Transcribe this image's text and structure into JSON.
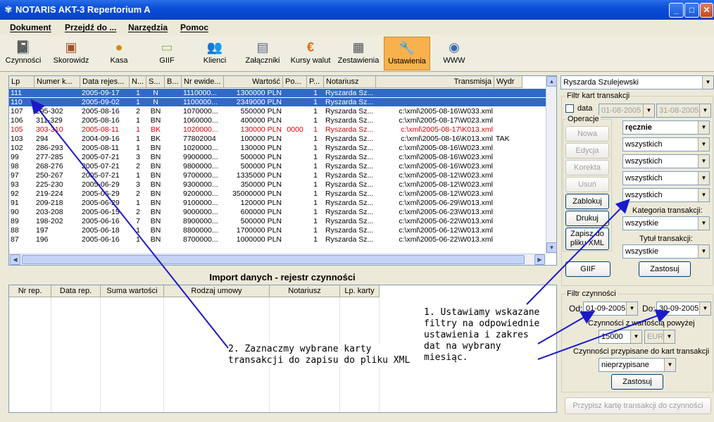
{
  "window": {
    "title": "NOTARIS AKT-3 Repertorium A",
    "icon": "app-icon",
    "min": "_",
    "max": "□",
    "close": "✕"
  },
  "menu": [
    "Dokument",
    "Przejdź do ...",
    "Narzędzia",
    "Pomoc"
  ],
  "toolbar": [
    {
      "label": "Czynności",
      "icon": "notebook-icon"
    },
    {
      "label": "Skorowidz",
      "icon": "index-book-icon"
    },
    {
      "label": "Kasa",
      "icon": "coins-icon"
    },
    {
      "label": "GIIF",
      "icon": "folder-icon"
    },
    {
      "label": "Klienci",
      "icon": "people-icon"
    },
    {
      "label": "Załączniki",
      "icon": "attachment-icon"
    },
    {
      "label": "Kursy walut",
      "icon": "euro-icon"
    },
    {
      "label": "Zestawienia",
      "icon": "report-icon"
    },
    {
      "label": "Ustawienia",
      "icon": "tools-icon"
    },
    {
      "label": "WWW",
      "icon": "globe-icon"
    }
  ],
  "colors": {
    "accent": "#316ac5",
    "active_tab": "#f7b24d",
    "red_row": "#e00000",
    "arrow": "#1a1acc"
  },
  "grid": {
    "headers": [
      "Lp",
      "Numer k...",
      "Data rejes...",
      "N...",
      "S...",
      "B...",
      "Nr ewide...",
      "Wartość",
      "Po...",
      "P...",
      "Notariusz",
      "Transmisja",
      "Wydr"
    ],
    "rows": [
      [
        "111",
        "",
        "2005-09-17",
        "1",
        "N",
        "",
        "1110000...",
        "1300000 PLN",
        "",
        "1",
        "Ryszarda Sz...",
        "",
        ""
      ],
      [
        "110",
        "",
        "2005-09-02",
        "1",
        "N",
        "",
        "1100000...",
        "2349000 PLN",
        "",
        "1",
        "Ryszarda Sz...",
        "",
        ""
      ],
      [
        "107",
        "295-302",
        "2005-08-16",
        "2",
        "BN",
        "",
        "1070000...",
        "550000 PLN",
        "",
        "1",
        "Ryszarda Sz...",
        "c:\\xml\\2005-08-16\\W033.xml",
        ""
      ],
      [
        "106",
        "311-329",
        "2005-08-16",
        "1",
        "BN",
        "",
        "1060000...",
        "400000 PLN",
        "",
        "1",
        "Ryszarda Sz...",
        "c:\\xml\\2005-08-17\\W023.xml",
        ""
      ],
      [
        "105",
        "303-310",
        "2005-08-11",
        "1",
        "BK",
        "",
        "1020000...",
        "130000 PLN",
        "0000",
        "1",
        "Ryszarda Sz...",
        "c:\\xml\\2005-08-17\\K013.xml",
        ""
      ],
      [
        "103",
        "294",
        "2004-09-16",
        "1",
        "BK",
        "",
        "77802004",
        "100000 PLN",
        "",
        "1",
        "Ryszarda Sz...",
        "c:\\xml\\2005-08-16\\K013.xml",
        "TAK"
      ],
      [
        "102",
        "286-293",
        "2005-08-11",
        "1",
        "BN",
        "",
        "1020000...",
        "130000 PLN",
        "",
        "1",
        "Ryszarda Sz...",
        "c:\\xml\\2005-08-16\\W023.xml",
        ""
      ],
      [
        "99",
        "277-285",
        "2005-07-21",
        "3",
        "BN",
        "",
        "9900000...",
        "500000 PLN",
        "",
        "1",
        "Ryszarda Sz...",
        "c:\\xml\\2005-08-16\\W023.xml",
        ""
      ],
      [
        "98",
        "268-276",
        "2005-07-21",
        "2",
        "BN",
        "",
        "9800000...",
        "500000 PLN",
        "",
        "1",
        "Ryszarda Sz...",
        "c:\\xml\\2005-08-16\\W023.xml",
        ""
      ],
      [
        "97",
        "250-267",
        "2005-07-21",
        "1",
        "BN",
        "",
        "9700000...",
        "1335000 PLN",
        "",
        "1",
        "Ryszarda Sz...",
        "c:\\xml\\2005-08-12\\W023.xml",
        ""
      ],
      [
        "93",
        "225-230",
        "2005-06-29",
        "3",
        "BN",
        "",
        "9300000...",
        "350000 PLN",
        "",
        "1",
        "Ryszarda Sz...",
        "c:\\xml\\2005-08-12\\W023.xml",
        ""
      ],
      [
        "92",
        "219-224",
        "2005-06-29",
        "2",
        "BN",
        "",
        "9200000...",
        "35000000 PLN",
        "",
        "1",
        "Ryszarda Sz...",
        "c:\\xml\\2005-08-12\\W023.xml",
        ""
      ],
      [
        "91",
        "209-218",
        "2005-06-29",
        "1",
        "BN",
        "",
        "9100000...",
        "120000 PLN",
        "",
        "1",
        "Ryszarda Sz...",
        "c:\\xml\\2005-06-29\\W013.xml",
        ""
      ],
      [
        "90",
        "203-208",
        "2005-06-15",
        "2",
        "BN",
        "",
        "9000000...",
        "600000 PLN",
        "",
        "1",
        "Ryszarda Sz...",
        "c:\\xml\\2005-06-23\\W013.xml",
        ""
      ],
      [
        "89",
        "198-202",
        "2005-06-16",
        "7",
        "BN",
        "",
        "8900000...",
        "500000 PLN",
        "",
        "1",
        "Ryszarda Sz...",
        "c:\\xml\\2005-06-22\\W013.xml",
        ""
      ],
      [
        "88",
        "197",
        "2005-06-18",
        "1",
        "BN",
        "",
        "8800000...",
        "1700000 PLN",
        "",
        "1",
        "Ryszarda Sz...",
        "c:\\xml\\2005-06-12\\W013.xml",
        ""
      ],
      [
        "87",
        "196",
        "2005-06-16",
        "1",
        "BN",
        "",
        "8700000...",
        "1000000 PLN",
        "",
        "1",
        "Ryszarda Sz...",
        "c:\\xml\\2005-06-22\\W013.xml",
        ""
      ]
    ],
    "selected_rows": [
      0,
      1
    ],
    "red_rows": [
      4
    ]
  },
  "import": {
    "title": "Import danych - rejestr czynności",
    "headers": [
      "Nr rep.",
      "Data rep.",
      "Suma wartości",
      "Rodzaj umowy",
      "Notariusz",
      "Lp. karty"
    ]
  },
  "right": {
    "notary": "Ryszarda Szulejewski",
    "filter_title": "Filtr kart transakcji",
    "date_label": "data",
    "date_from": "01-08-2005",
    "date_to": "31-08-2005",
    "ops_title": "Operacje",
    "ops": [
      "Nowa",
      "Edycja",
      "Korekta",
      "Usuń",
      "Zablokuj",
      "Drukuj",
      "Zapisz do pliku XML"
    ],
    "combos": [
      "ręcznie",
      "wszystkich",
      "wszystkich",
      "wszystkich",
      "wszystkich"
    ],
    "kat_label": "Kategoria transakcji:",
    "kat_value": "wszystkie",
    "tytul_label": "Tytuł transakcji:",
    "tytul_value": "wszystkie",
    "giif": "GIIF",
    "apply1": "Zastosuj",
    "filtr_czyn_title": "Filtr czynności",
    "od_label": "Od:",
    "od_value": "01-09-2005",
    "do_label": "Do:",
    "do_value": "30-09-2005",
    "wartosc_label": "Czynności z wartością powyżej",
    "wartosc_value": "15000",
    "currency": "EUR",
    "przypisane_label": "Czynności przypisane do kart transakcji",
    "przypisane_value": "nieprzypisane",
    "apply2": "Zastosuj",
    "assign_btn": "Przypisz kartę transakcji do czynności"
  },
  "notes": {
    "n1": "1. Ustawiamy wskazane filtry na odpowiednie ustawienia i zakres dat na wybrany miesiąc.",
    "n2": "2. Zaznaczmy wybrane karty transakcji do zapisu do pliku XML"
  }
}
